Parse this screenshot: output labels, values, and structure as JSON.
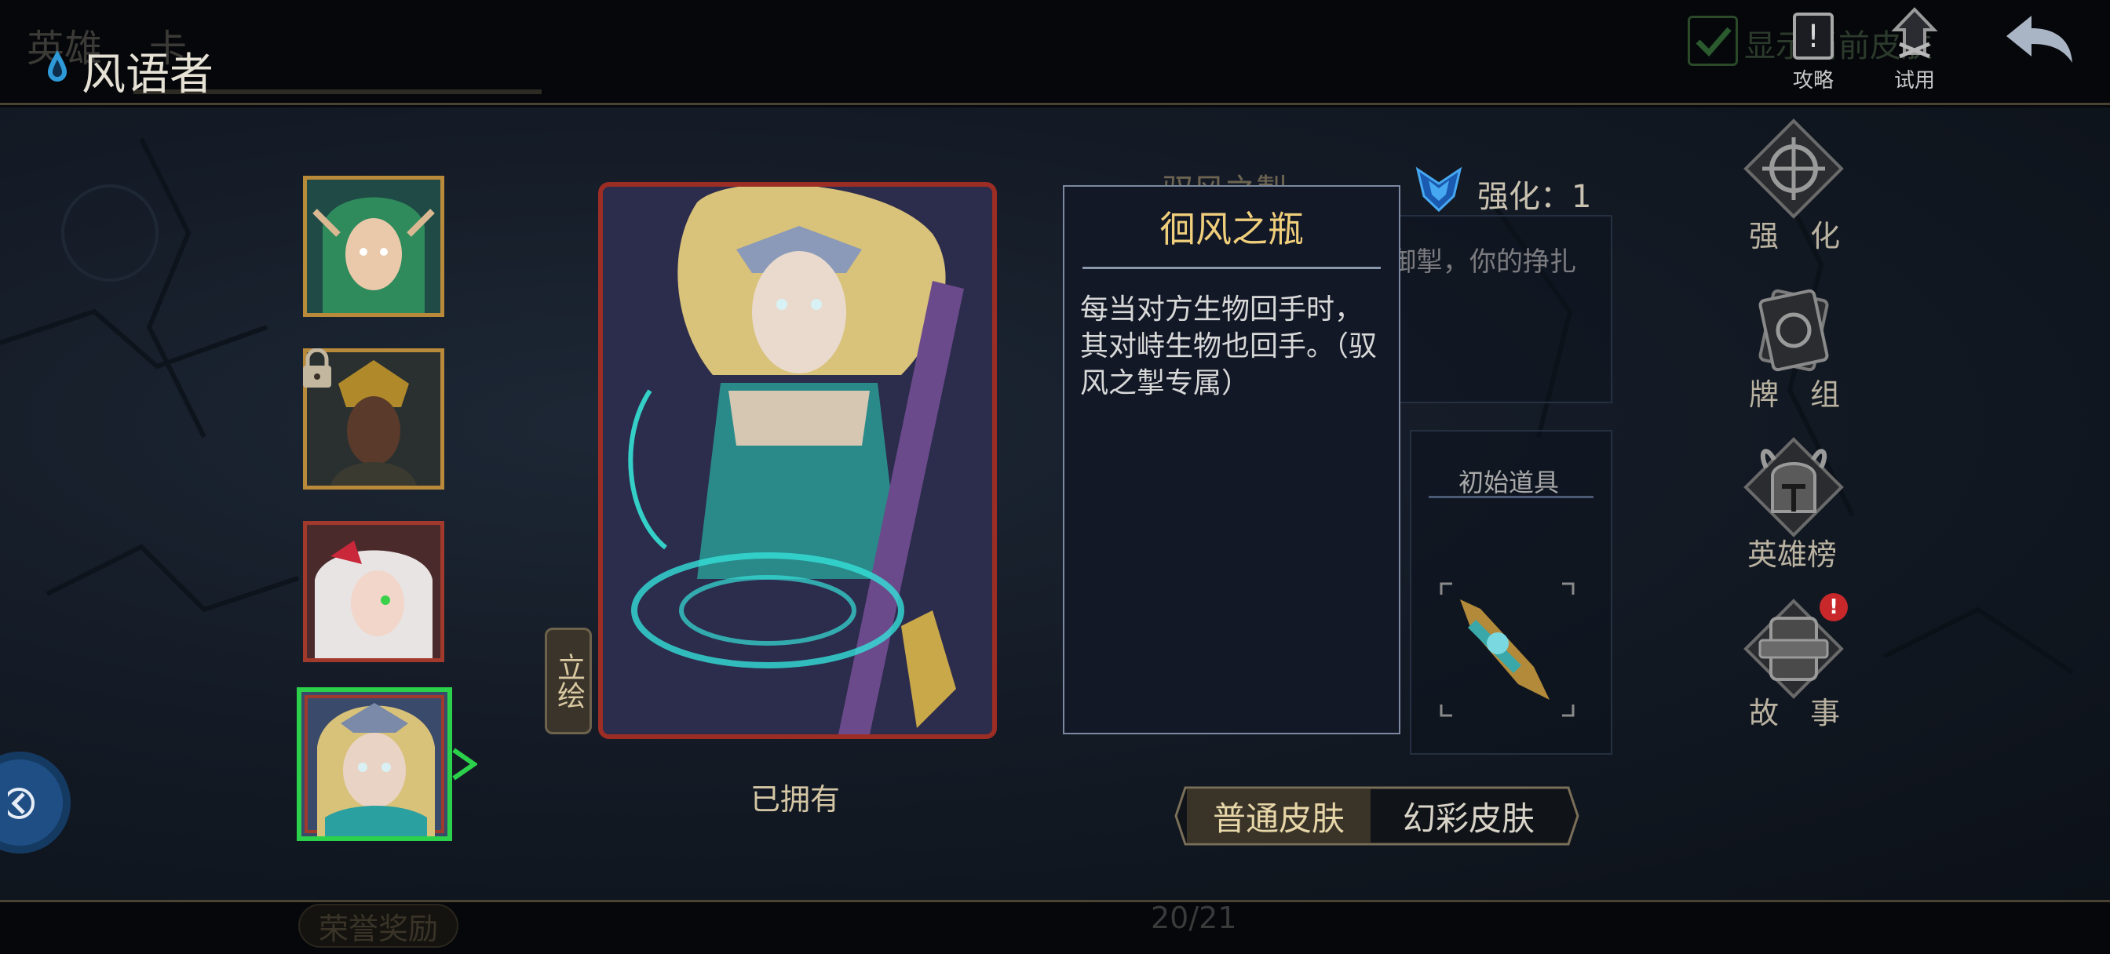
{
  "header": {
    "faded_tab_1": "英雄",
    "faded_tab_2": "卡",
    "hero_name": "风语者",
    "show_current_skin_label": "显示当前皮肤",
    "guide_label": "攻略",
    "trial_label": "试用"
  },
  "heroes": [
    {
      "name": "hero-1",
      "locked": false,
      "selected": false
    },
    {
      "name": "hero-2",
      "locked": true,
      "selected": false
    },
    {
      "name": "hero-3",
      "locked": false,
      "selected": false
    },
    {
      "name": "hero-4",
      "locked": false,
      "selected": true
    }
  ],
  "card": {
    "art_tab_label": "立绘",
    "owned_label": "已拥有"
  },
  "tooltip": {
    "title": "徊风之瓶",
    "description": "每当对方生物回手时，其对峙生物也回手。（驭风之掣专属）"
  },
  "ability": {
    "name_partial": "驭风之掣",
    "desc_partial": "御掣，你的挣扎"
  },
  "enhance": {
    "label": "强化：1"
  },
  "starting_item": {
    "label": "初始道具"
  },
  "side_menu": {
    "enhance": "强 化",
    "deck": "牌 组",
    "leaderboard": "英雄榜",
    "story": "故 事",
    "story_badge": "!"
  },
  "skins": {
    "normal": "普通皮肤",
    "rainbow": "幻彩皮肤",
    "selected": "normal"
  },
  "footer": {
    "rewards_label": "荣誉奖励",
    "page_counter": "20/21"
  },
  "colors": {
    "gold": "#f0cf7c",
    "selected_border": "#2bd14a",
    "card_border": "#9c2d25",
    "badge_red": "#c8282a"
  }
}
